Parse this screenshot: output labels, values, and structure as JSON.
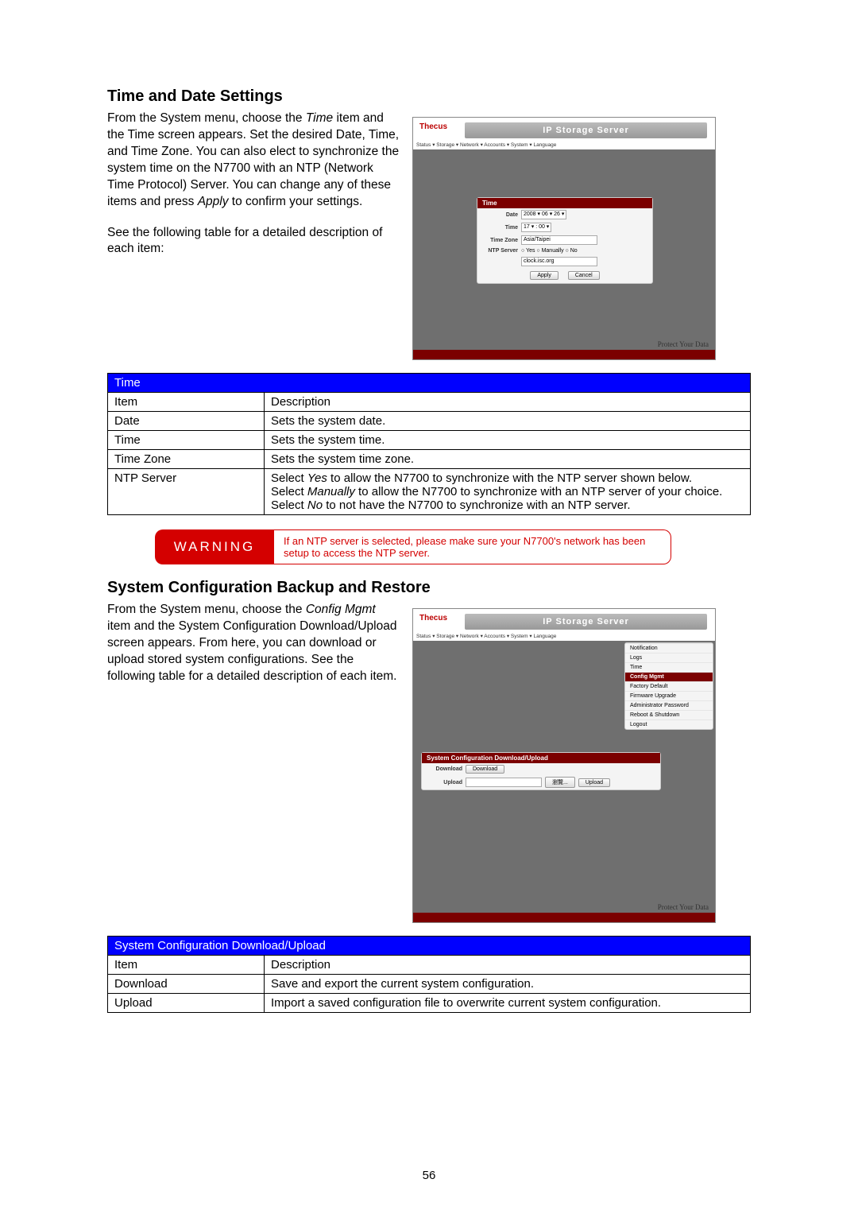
{
  "section1": {
    "heading": "Time and Date Settings",
    "para1": "From the System menu, choose the Time item and the Time screen appears. Set the desired Date, Time, and Time Zone. You can also elect to synchronize the system time on the N7700 with an NTP (Network Time Protocol) Server. You can change any of these items and press Apply to confirm your settings.",
    "para2": "See the following table for a detailed description of each item:"
  },
  "screenshot1": {
    "brand": "Thecus",
    "title": "IP Storage Server",
    "menu": "Status ▾   Storage ▾   Network ▾   Accounts ▾   System ▾   Language",
    "panel_title": "Time",
    "rows": {
      "date_label": "Date",
      "date_val": "2008 ▾  06 ▾  26 ▾",
      "time_label": "Time",
      "time_val": "17 ▾ : 00 ▾",
      "tz_label": "Time Zone",
      "tz_val": "Asia/Taipei",
      "ntp_label": "NTP Server",
      "ntp_opts": "○ Yes  ○ Manually  ○ No",
      "ntp_val": "clock.isc.org",
      "apply": "Apply",
      "cancel": "Cancel"
    },
    "protect": "Protect Your Data"
  },
  "table1": {
    "title": "Time",
    "header_item": "Item",
    "header_desc": "Description",
    "rows": [
      {
        "item": "Date",
        "desc": "Sets the system date."
      },
      {
        "item": "Time",
        "desc": "Sets the system time."
      },
      {
        "item": "Time Zone",
        "desc": "Sets the system time zone."
      },
      {
        "item": "NTP Server",
        "desc": "Select Yes to allow the N7700 to synchronize with the NTP server shown below.\nSelect Manually to allow the N7700 to synchronize with an NTP server of your choice.\nSelect No to not have the N7700 to synchronize with an NTP server."
      }
    ]
  },
  "warning": {
    "label": "WARNING",
    "text": "If an NTP server is selected, please make sure your N7700's network has been setup to access the NTP server."
  },
  "section2": {
    "heading": "System Configuration Backup and Restore",
    "para": "From the System menu, choose the Config Mgmt item and the System Configuration Download/Upload screen appears. From here, you can download or upload stored system configurations. See the following table for a detailed description of each item."
  },
  "screenshot2": {
    "brand": "Thecus",
    "title": "IP Storage Server",
    "menu": "Status ▾   Storage ▾   Network ▾   Accounts ▾   System ▾   Language",
    "side": {
      "s1": "Notification",
      "s2": "Logs",
      "s3": "Time",
      "s4": "Config Mgmt",
      "s5": "Factory Default",
      "s6": "Firmware Upgrade",
      "s7": "Administrator Password",
      "s8": "Reboot & Shutdown",
      "s9": "Logout"
    },
    "panel_title": "System Configuration Download/Upload",
    "dl_label": "Download",
    "dl_btn": "Download",
    "ul_label": "Upload",
    "ul_browse": "瀏覽...",
    "ul_btn": "Upload",
    "protect": "Protect Your Data"
  },
  "table2": {
    "title": "System Configuration Download/Upload",
    "header_item": "Item",
    "header_desc": "Description",
    "rows": [
      {
        "item": "Download",
        "desc": "Save and export the current system configuration."
      },
      {
        "item": "Upload",
        "desc": "Import a saved configuration file to overwrite current system configuration."
      }
    ]
  },
  "page_number": "56"
}
